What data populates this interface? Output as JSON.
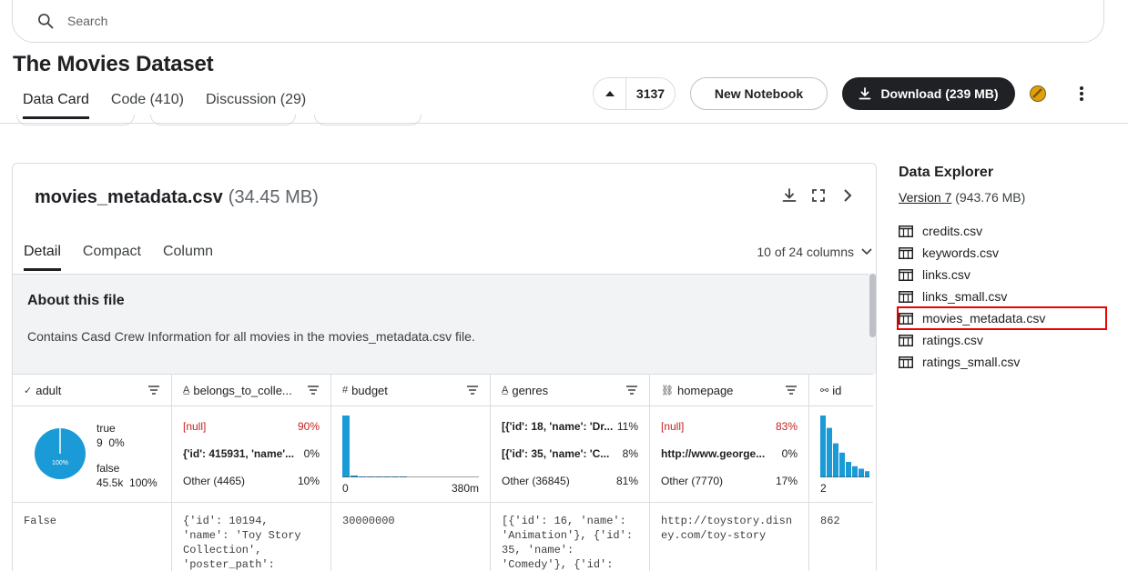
{
  "search": {
    "placeholder": "Search"
  },
  "dataset": {
    "title": "The Movies Dataset"
  },
  "tabs": [
    {
      "label": "Data Card"
    },
    {
      "label": "Code (410)"
    },
    {
      "label": "Discussion (29)"
    }
  ],
  "actions": {
    "votes": "3137",
    "new_notebook": "New Notebook",
    "download": "Download (239 MB)"
  },
  "file": {
    "name": "movies_metadata.csv",
    "size": "(34.45 MB)",
    "subtabs": [
      "Detail",
      "Compact",
      "Column"
    ],
    "columns_shown": "10 of 24 columns",
    "about_title": "About this file",
    "about_text": "Contains Casd Crew Information for all movies in the movies_metadata.csv file."
  },
  "columns": [
    {
      "name": "adult",
      "type_icon": "check-icon",
      "pie": {
        "true_count": "9",
        "true_pct": "0%",
        "false_count": "45.5k",
        "false_pct": "100%",
        "center_label": "100%",
        "true_label": "true",
        "false_label": "false",
        "false_fraction": 1.0
      },
      "first_value": "False"
    },
    {
      "name": "belongs_to_colle...",
      "type_icon": "text-icon",
      "stats": [
        {
          "label": "[null]",
          "pct": "90%",
          "kind": "null"
        },
        {
          "label": "{'id': 415931, 'name'...",
          "pct": "0%",
          "kind": "bold"
        },
        {
          "label": "Other (4465)",
          "pct": "10%",
          "kind": "other"
        }
      ],
      "first_value": "{'id': 10194,\n'name': 'Toy Story\nCollection',\n'poster_path':"
    },
    {
      "name": "budget",
      "type_icon": "hash-icon",
      "hist": {
        "min": "0",
        "max": "380m",
        "bars": [
          1.0,
          0.03,
          0.01,
          0.01,
          0.005,
          0.005,
          0.003,
          0.002
        ]
      },
      "first_value": "30000000"
    },
    {
      "name": "genres",
      "type_icon": "text-icon",
      "stats": [
        {
          "label": "[{'id': 18, 'name': 'Dr...",
          "pct": "11%",
          "kind": "bold"
        },
        {
          "label": "[{'id': 35, 'name': 'C...",
          "pct": "8%",
          "kind": "bold"
        },
        {
          "label": "Other (36845)",
          "pct": "81%",
          "kind": "other"
        }
      ],
      "first_value": "[{'id': 16, 'name':\n'Animation'}, {'id':\n35, 'name':\n'Comedy'}, {'id':"
    },
    {
      "name": "homepage",
      "type_icon": "link-icon",
      "stats": [
        {
          "label": "[null]",
          "pct": "83%",
          "kind": "null"
        },
        {
          "label": "http://www.george...",
          "pct": "0%",
          "kind": "bold"
        },
        {
          "label": "Other (7770)",
          "pct": "17%",
          "kind": "other"
        }
      ],
      "first_value": "http://toystory.disn\ney.com/toy-story"
    },
    {
      "name": "id",
      "type_icon": "key-icon",
      "hist": {
        "min": "2",
        "max": "",
        "bars": [
          1.0,
          0.8,
          0.55,
          0.4,
          0.25,
          0.18,
          0.14,
          0.1
        ]
      },
      "first_value": "862"
    }
  ],
  "explorer": {
    "title": "Data Explorer",
    "version_link": "Version 7",
    "version_size": "(943.76 MB)",
    "files": [
      "credits.csv",
      "keywords.csv",
      "links.csv",
      "links_small.csv",
      "movies_metadata.csv",
      "ratings.csv",
      "ratings_small.csv"
    ],
    "selected_index": 4
  },
  "colors": {
    "accent_blue": "#1a9ad6",
    "null_red": "#c5221f",
    "highlight": "#ee0000"
  }
}
